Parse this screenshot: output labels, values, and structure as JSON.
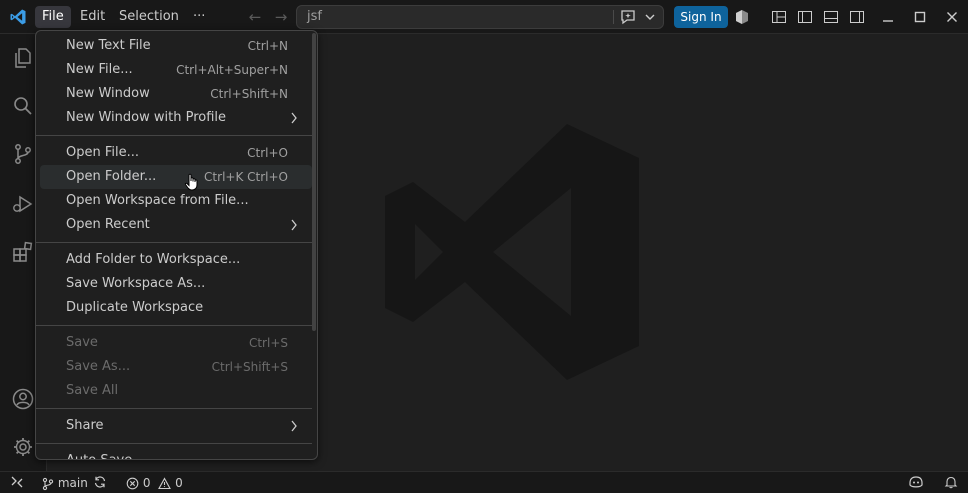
{
  "titlebar": {
    "menus": [
      "File",
      "Edit",
      "Selection",
      "···"
    ],
    "search_text": "jsf",
    "signin_label": "Sign In"
  },
  "file_menu": {
    "groups": [
      [
        {
          "label": "New Text File",
          "shortcut": "Ctrl+N"
        },
        {
          "label": "New File...",
          "shortcut": "Ctrl+Alt+Super+N"
        },
        {
          "label": "New Window",
          "shortcut": "Ctrl+Shift+N"
        },
        {
          "label": "New Window with Profile",
          "shortcut": "",
          "submenu": true
        }
      ],
      [
        {
          "label": "Open File...",
          "shortcut": "Ctrl+O"
        },
        {
          "label": "Open Folder...",
          "shortcut": "Ctrl+K Ctrl+O",
          "hover": true
        },
        {
          "label": "Open Workspace from File...",
          "shortcut": ""
        },
        {
          "label": "Open Recent",
          "shortcut": "",
          "submenu": true
        }
      ],
      [
        {
          "label": "Add Folder to Workspace...",
          "shortcut": ""
        },
        {
          "label": "Save Workspace As...",
          "shortcut": ""
        },
        {
          "label": "Duplicate Workspace",
          "shortcut": ""
        }
      ],
      [
        {
          "label": "Save",
          "shortcut": "Ctrl+S",
          "disabled": true
        },
        {
          "label": "Save As...",
          "shortcut": "Ctrl+Shift+S",
          "disabled": true
        },
        {
          "label": "Save All",
          "shortcut": "",
          "disabled": true
        }
      ],
      [
        {
          "label": "Share",
          "shortcut": "",
          "submenu": true
        }
      ],
      [
        {
          "label": "Auto Save",
          "shortcut": ""
        }
      ]
    ]
  },
  "statusbar": {
    "branch": "main",
    "errors": "0",
    "warnings": "0"
  },
  "colors": {
    "accent": "#0e639c",
    "background": "#1f1f1f",
    "chrome": "#181818"
  }
}
